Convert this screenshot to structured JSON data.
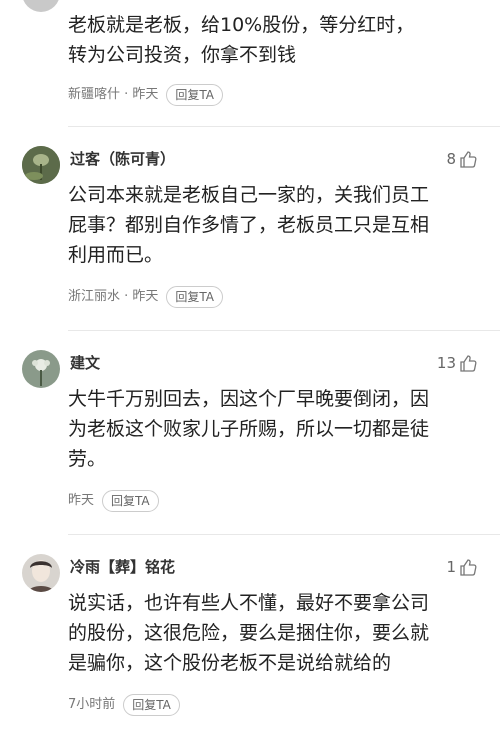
{
  "comments": [
    {
      "user": "",
      "likes": "",
      "text": "老板就是老板，给10%股份，等分红时，\n转为公司投资，你拿不到钱",
      "meta": "新疆喀什 · 昨天",
      "reply": "回复TA"
    },
    {
      "user": "过客（陈可青）",
      "likes": "8",
      "text": "公司本来就是老板自己一家的，关我们员工\n屁事？都别自作多情了，老板员工只是互相\n利用而已。",
      "meta": "浙江丽水 · 昨天",
      "reply": "回复TA"
    },
    {
      "user": "建文",
      "likes": "13",
      "text": "大牛千万别回去，因这个厂早晚要倒闭，因\n为老板这个败家儿子所赐，所以一切都是徒\n劳。",
      "meta": "昨天",
      "reply": "回复TA"
    },
    {
      "user": "冷雨【葬】铭花",
      "likes": "1",
      "text": "说实话，也许有些人不懂，最好不要拿公司\n的股份，这很危险，要么是捆住你，要么就\n是骗你，这个股份老板不是说给就给的",
      "meta": "7小时前",
      "reply": "回复TA"
    }
  ]
}
